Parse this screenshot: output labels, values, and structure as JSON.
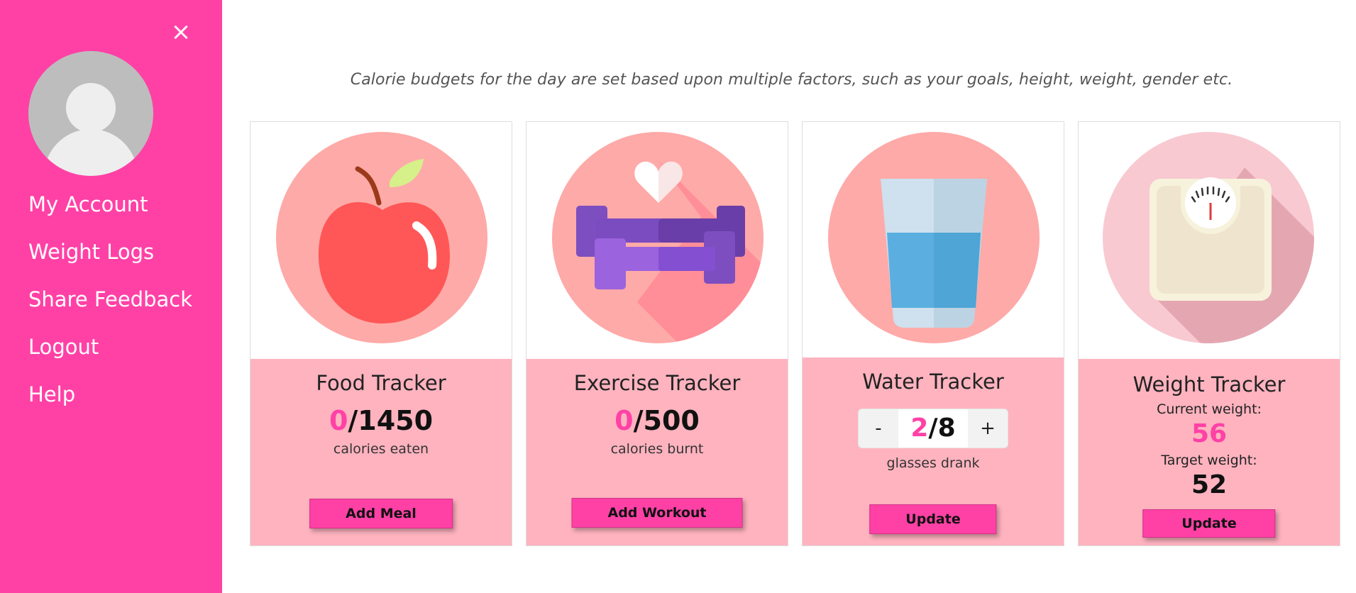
{
  "sidebar": {
    "close_label": "×",
    "items": [
      {
        "label": "My Account"
      },
      {
        "label": "Weight Logs"
      },
      {
        "label": "Share Feedback"
      },
      {
        "label": "Logout"
      },
      {
        "label": "Help"
      }
    ]
  },
  "intro_text": "Calorie budgets for the day are set based upon multiple factors, such as your goals, height, weight, gender etc.",
  "food": {
    "title": "Food Tracker",
    "current": "0",
    "total": "/1450",
    "sub": "calories eaten",
    "button": "Add Meal"
  },
  "exercise": {
    "title": "Exercise Tracker",
    "current": "0",
    "total": "/500",
    "sub": "calories burnt",
    "button": "Add Workout"
  },
  "water": {
    "title": "Water Tracker",
    "minus": "-",
    "plus": "+",
    "current": "2",
    "total": "/8",
    "sub": "glasses drank",
    "button": "Update"
  },
  "weight": {
    "title": "Weight Tracker",
    "current_label": "Current weight:",
    "current_value": "56",
    "target_label": "Target weight:",
    "target_value": "52",
    "button": "Update"
  },
  "colors": {
    "accent": "#ff41a6",
    "card_body": "#feb3bf"
  }
}
